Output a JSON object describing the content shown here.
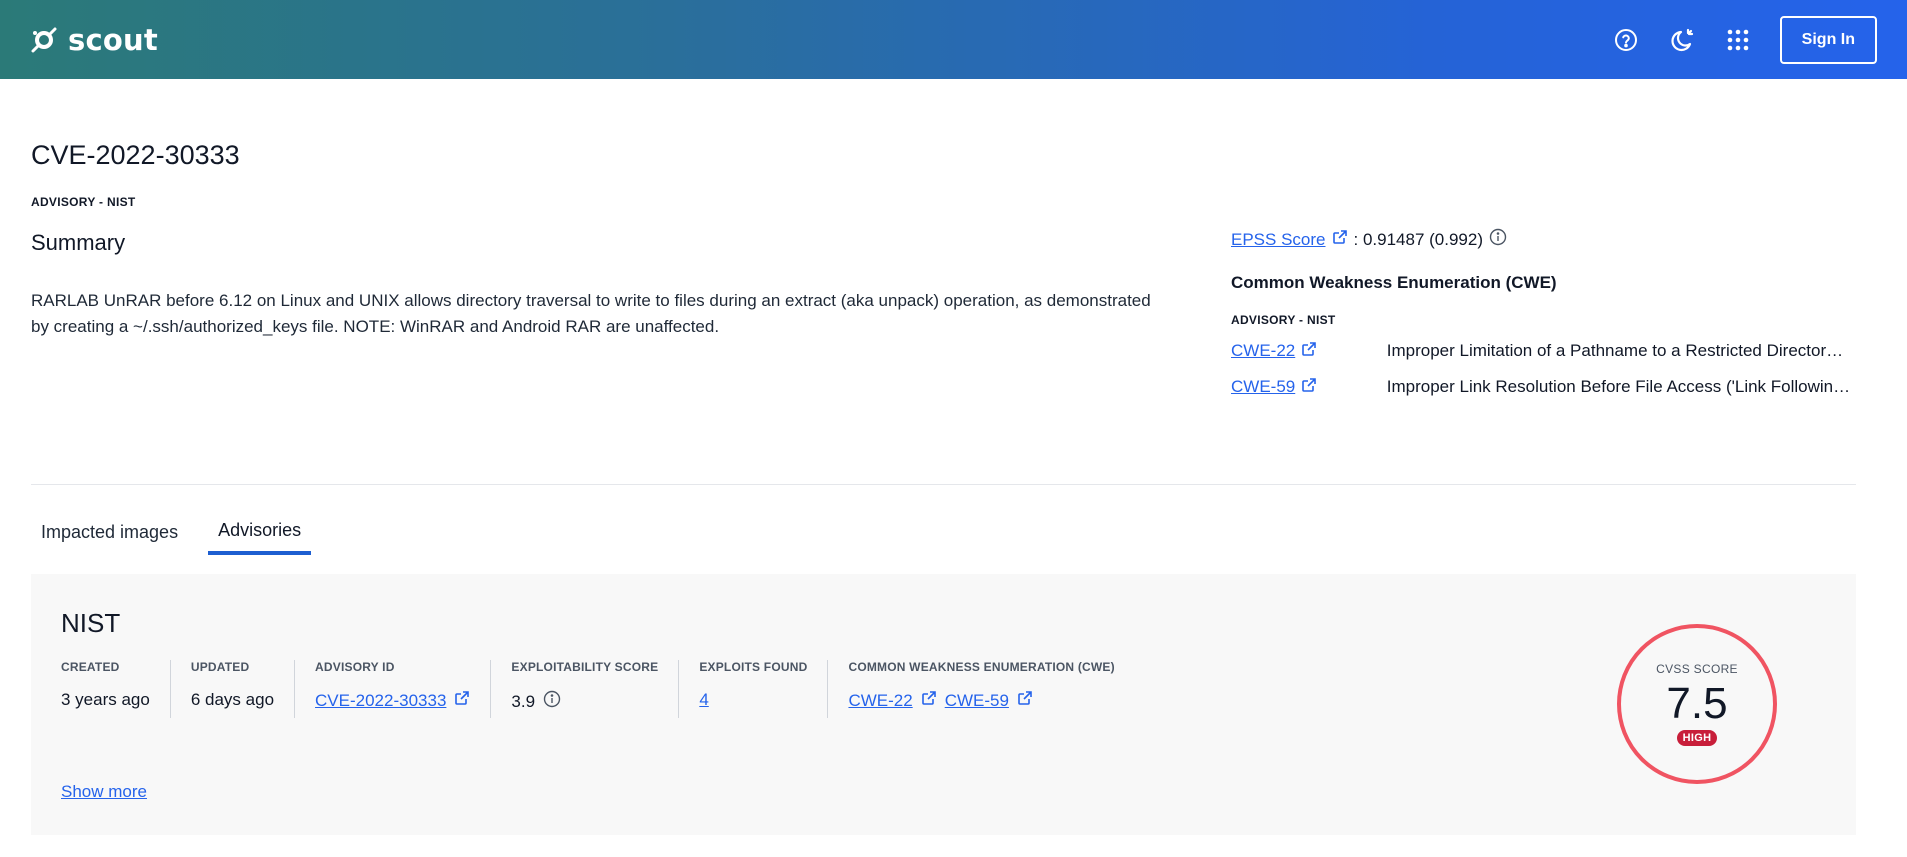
{
  "header": {
    "brand": "scout",
    "help_icon": "help-circle-icon",
    "theme_icon": "moon-sun-icon",
    "apps_icon": "apps-grid-icon",
    "signin_label": "Sign In"
  },
  "cve": {
    "id": "CVE-2022-30333",
    "advisory_source": "ADVISORY - NIST",
    "summary_heading": "Summary",
    "summary_text": "RARLAB UnRAR before 6.12 on Linux and UNIX allows directory traversal to write to files during an extract (aka unpack) operation, as demonstrated by creating a ~/.ssh/authorized_keys file. NOTE: WinRAR and Android RAR are unaffected."
  },
  "side": {
    "epss_label": "EPSS Score",
    "epss_value": ": 0.91487 (0.992)",
    "cwe_heading": "Common Weakness Enumeration (CWE)",
    "cwe_source": "ADVISORY - NIST",
    "cwes": [
      {
        "id": "CWE-22",
        "desc": "Improper Limitation of a Pathname to a Restricted Directory ('Path Traversal')"
      },
      {
        "id": "CWE-59",
        "desc": "Improper Link Resolution Before File Access ('Link Following')"
      }
    ]
  },
  "tabs": [
    {
      "label": "Impacted images",
      "active": false
    },
    {
      "label": "Advisories",
      "active": true
    }
  ],
  "advisory": {
    "title": "NIST",
    "created_label": "CREATED",
    "created_value": "3 years ago",
    "updated_label": "UPDATED",
    "updated_value": "6 days ago",
    "advisory_id_label": "ADVISORY ID",
    "advisory_id_value": "CVE-2022-30333",
    "exploitability_label": "EXPLOITABILITY SCORE",
    "exploitability_value": "3.9",
    "exploits_label": "EXPLOITS FOUND",
    "exploits_value": "4",
    "cwe_label": "COMMON WEAKNESS ENUMERATION (CWE)",
    "cwe_links": [
      "CWE-22",
      "CWE-59"
    ],
    "show_more": "Show more",
    "cvss_label": "CVSS SCORE",
    "cvss_score": "7.5",
    "cvss_severity": "HIGH"
  },
  "colors": {
    "accent": "#2563eb",
    "cvss_ring": "#f05462",
    "severity_high": "#c81e3a"
  }
}
